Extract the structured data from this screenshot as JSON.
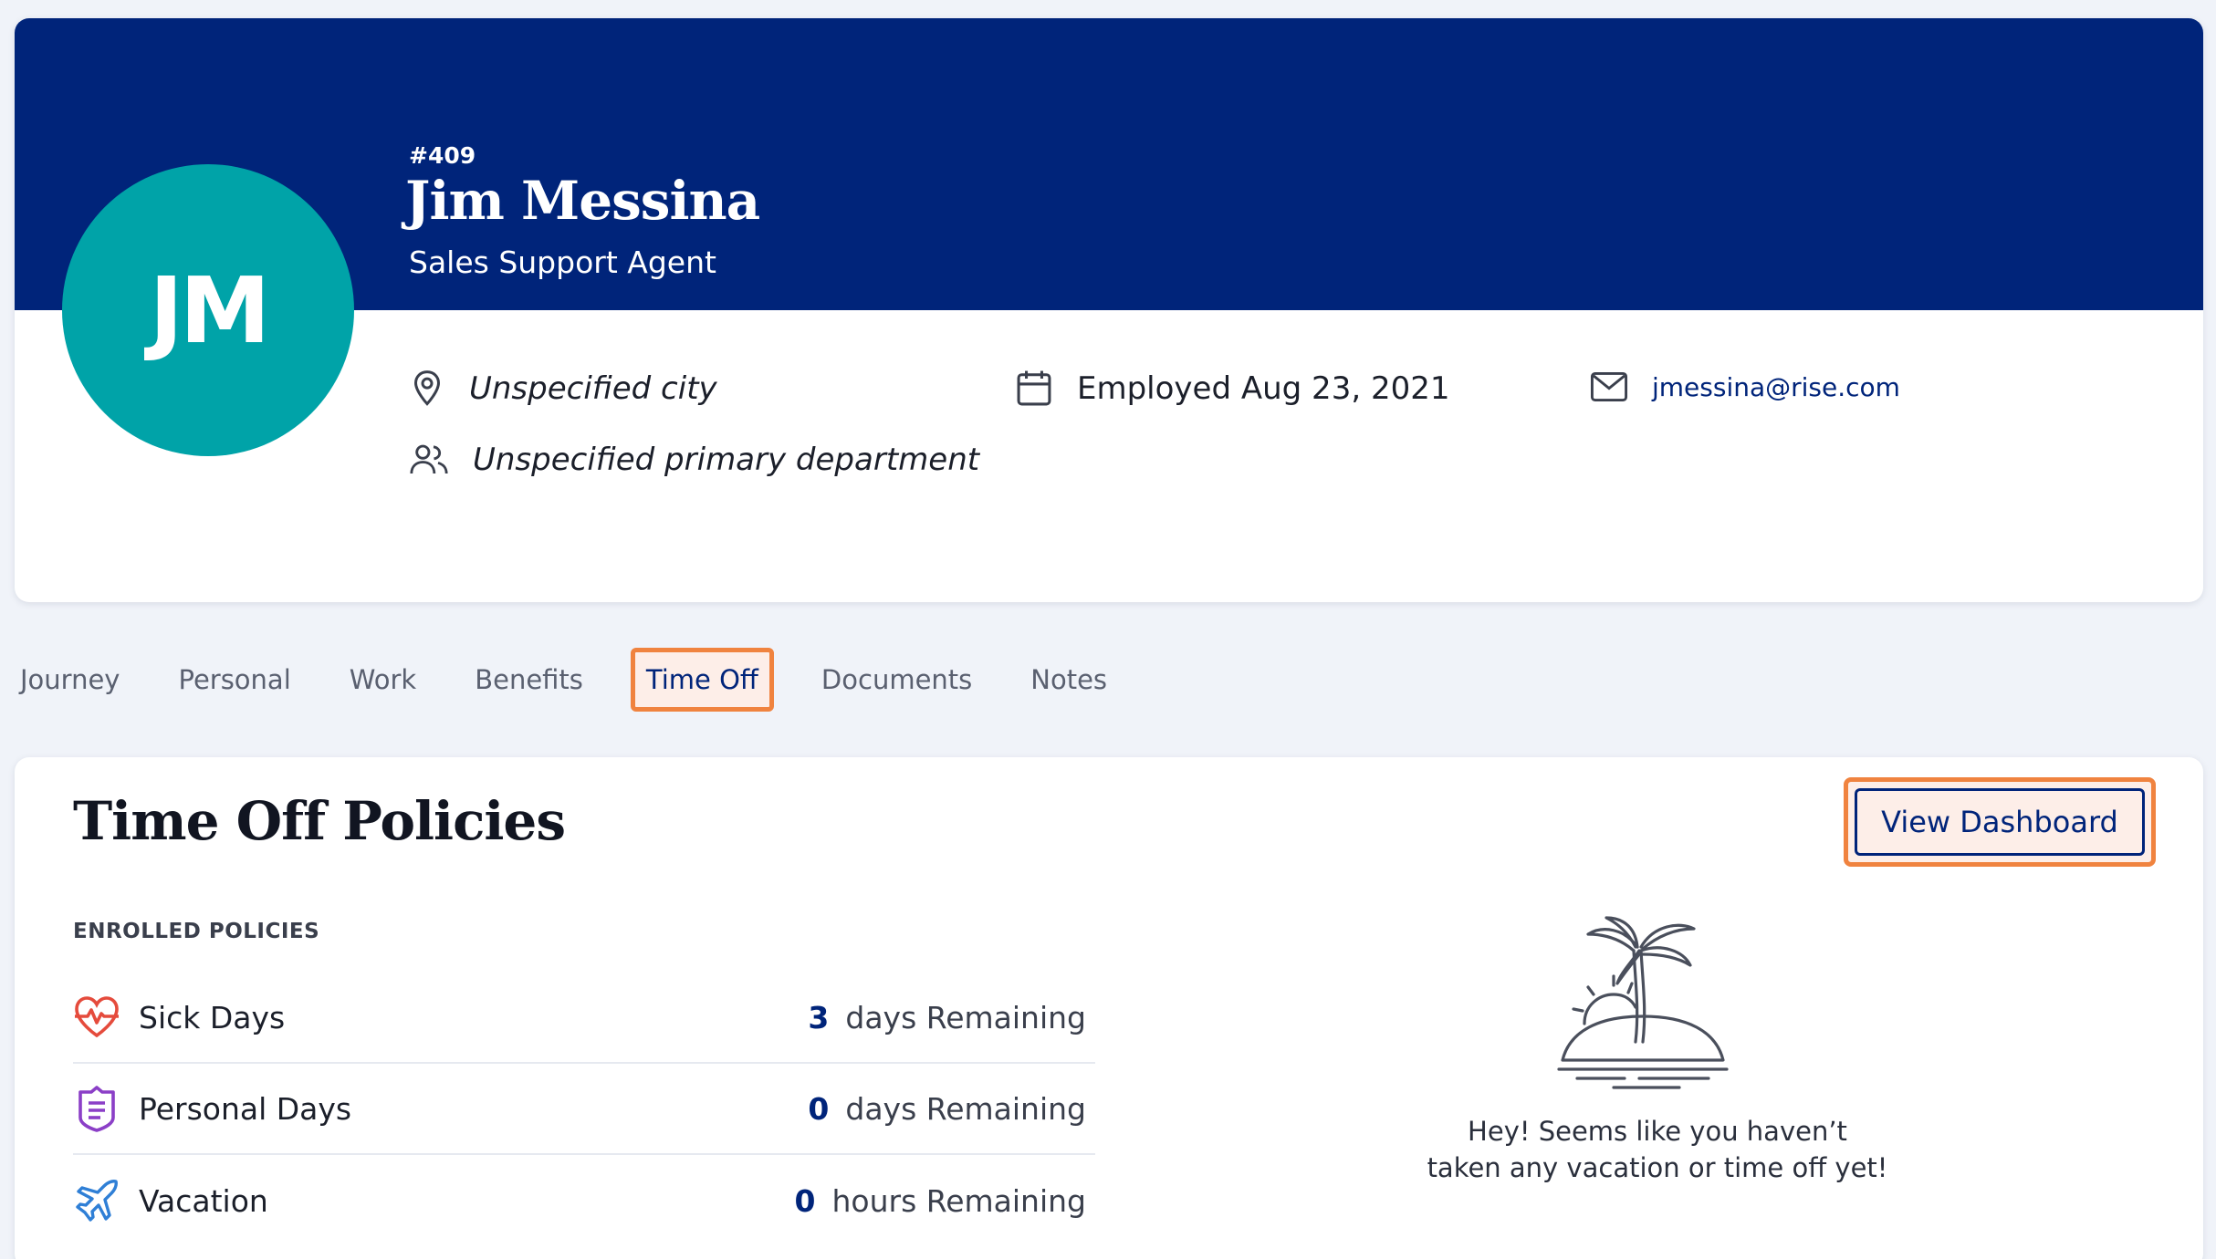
{
  "profile": {
    "initials": "JM",
    "employee_number": "#409",
    "name": "Jim Messina",
    "job_title": "Sales Support Agent",
    "city": "Unspecified city",
    "department": "Unspecified primary department",
    "employment": "Employed Aug 23, 2021",
    "email": "jmessina@rise.com",
    "avatar_color": "#00a3a8",
    "banner_color": "#00247a"
  },
  "tabs": [
    {
      "label": "Journey"
    },
    {
      "label": "Personal"
    },
    {
      "label": "Work"
    },
    {
      "label": "Benefits"
    },
    {
      "label": "Time Off",
      "active": true
    },
    {
      "label": "Documents"
    },
    {
      "label": "Notes"
    }
  ],
  "time_off": {
    "title": "Time Off Policies",
    "view_dashboard_label": "View Dashboard",
    "enrolled_heading": "ENROLLED POLICIES",
    "policies": [
      {
        "name": "Sick Days",
        "value": "3",
        "unit": "days Remaining",
        "icon": "heartbeat-icon"
      },
      {
        "name": "Personal Days",
        "value": "0",
        "unit": "days Remaining",
        "icon": "badge-icon"
      },
      {
        "name": "Vacation",
        "value": "0",
        "unit": "hours Remaining",
        "icon": "plane-icon"
      }
    ],
    "empty_line1": "Hey! Seems like you haven’t",
    "empty_line2": "taken any vacation or time off yet!"
  },
  "colors": {
    "accent": "#f0833f",
    "primary": "#00247a"
  }
}
